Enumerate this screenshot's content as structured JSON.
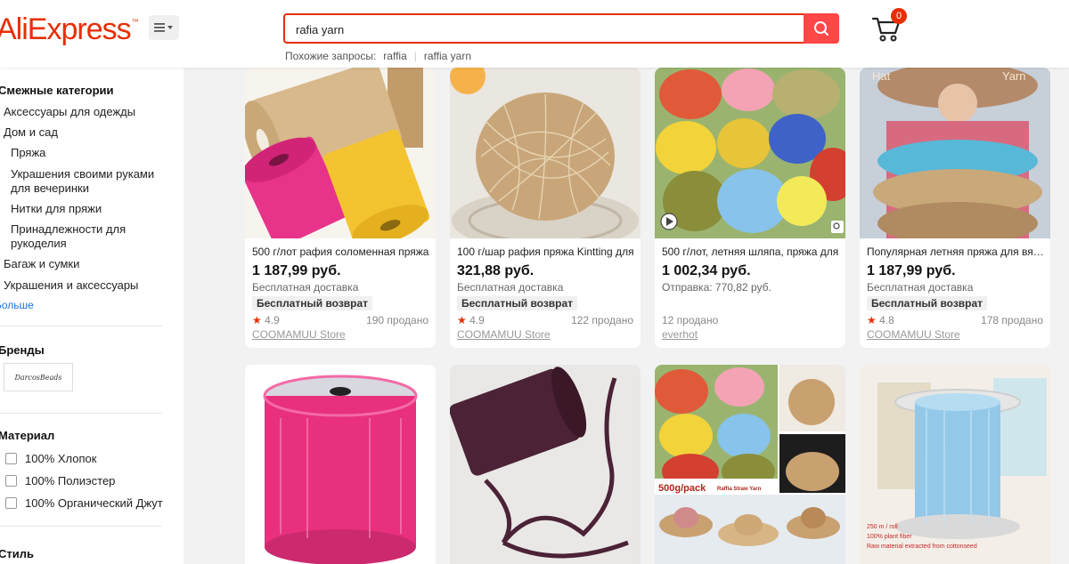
{
  "header": {
    "logo": "AliExpress",
    "logo_tm": "™",
    "search_value": "rafia yarn",
    "related_label": "Похожие запросы:",
    "related": [
      "raffia",
      "raffia yarn"
    ],
    "cart_count": "0"
  },
  "sidebar": {
    "categories_title": "Смежные категории",
    "categories": [
      "Аксессуары для одежды",
      "Дом и сад",
      "Пряжа",
      "Украшения своими руками для вечеринки",
      "Нитки для пряжи",
      "Принадлежности для рукоделия",
      "Багаж и сумки",
      "Украшения и аксессуары"
    ],
    "more": "Больше",
    "brands_title": "Бренды",
    "brand_logo_text": "DarcosBeads",
    "material_title": "Материал",
    "materials": [
      "100% Хлопок",
      "100% Полиэстер",
      "100% Органический Джут"
    ],
    "style_title": "Стиль"
  },
  "products": [
    {
      "title": "500 г/лот рафия соломенная пряжа",
      "price": "1 187,99 руб.",
      "shipping": "Бесплатная доставка",
      "return": "Бесплатный возврат",
      "rating": "4.9",
      "sold": "190 продано",
      "store": "COOMAMUU Store"
    },
    {
      "title": "100 г/шар рафия пряжа Kintting для",
      "price": "321,88 руб.",
      "shipping": "Бесплатная доставка",
      "return": "Бесплатный возврат",
      "rating": "4.9",
      "sold": "122 продано",
      "store": "COOMAMUU Store"
    },
    {
      "title": "500 г/лот, летняя шляпа, пряжа для",
      "price": "1 002,34 руб.",
      "shipping": "Отправка: 770,82 руб.",
      "return": "",
      "rating": "",
      "sold": "12 продано",
      "store": "everhot"
    },
    {
      "title": "Популярная летняя пряжа для вязания",
      "price": "1 187,99 руб.",
      "shipping": "Бесплатная доставка",
      "return": "Бесплатный возврат",
      "rating": "4.8",
      "sold": "178 продано",
      "store": "COOMAMUU Store"
    }
  ],
  "image_texts": {
    "hat_left": "Hat",
    "hat_right": "Yarn",
    "pack_label": "500g/pack",
    "pack_sub": "Raffia Straw Yarn",
    "spool_line1": "250 m / roll",
    "spool_line2": "100% plant fiber",
    "spool_line3": "Raw material extracted from cottonseed"
  },
  "colors": {
    "accent": "#e62e04",
    "search_button": "#ff4747",
    "link": "#1a73e8"
  }
}
